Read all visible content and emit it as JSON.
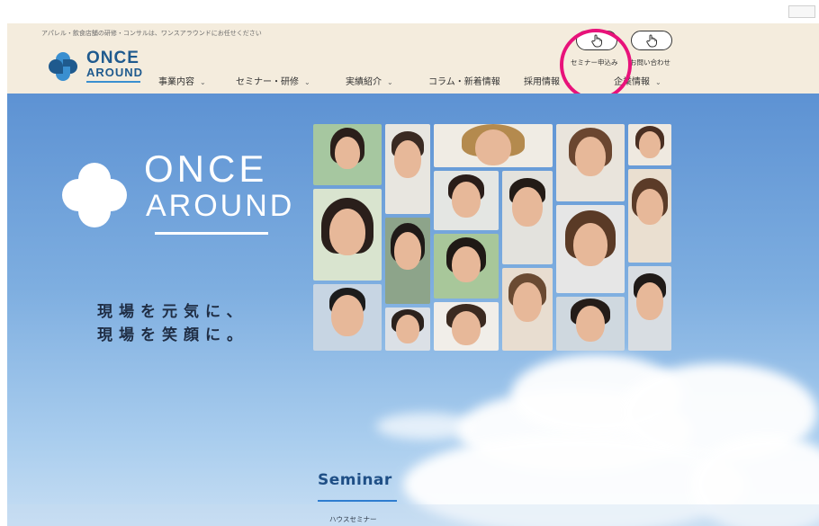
{
  "header": {
    "tagline": "アパレル・飲食店舗の研修・コンサルは、ワンスアラウンドにお任せください",
    "logo_line1": "ONCE",
    "logo_line2": "AROUND",
    "nav": [
      {
        "label": "事業内容",
        "has_dropdown": true
      },
      {
        "label": "セミナー・研修",
        "has_dropdown": true
      },
      {
        "label": "実績紹介",
        "has_dropdown": true
      },
      {
        "label": "コラム・新着情報",
        "has_dropdown": false
      },
      {
        "label": "採用情報",
        "has_dropdown": true
      },
      {
        "label": "企業情報",
        "has_dropdown": true
      }
    ],
    "seminar_button_label": "セミナー申込み",
    "contact_button_label": "お問い合わせ",
    "caret": "⌄"
  },
  "hero": {
    "logo_line1": "ONCE",
    "logo_line2": "AROUND",
    "slogan_line1": "現場を元気に、",
    "slogan_line2": "現場を笑顔に。"
  },
  "seminar": {
    "title": "Seminar",
    "subtitle": "ハウスセミナー"
  },
  "colors": {
    "brand_blue": "#1f5a8e",
    "header_bg": "#f4ecdd",
    "highlight": "#e8127a",
    "sky_top": "#5d92d3"
  },
  "icons": {
    "button_icon": "hand-pointer-icon",
    "logo_icon": "four-petal-logo-icon"
  }
}
